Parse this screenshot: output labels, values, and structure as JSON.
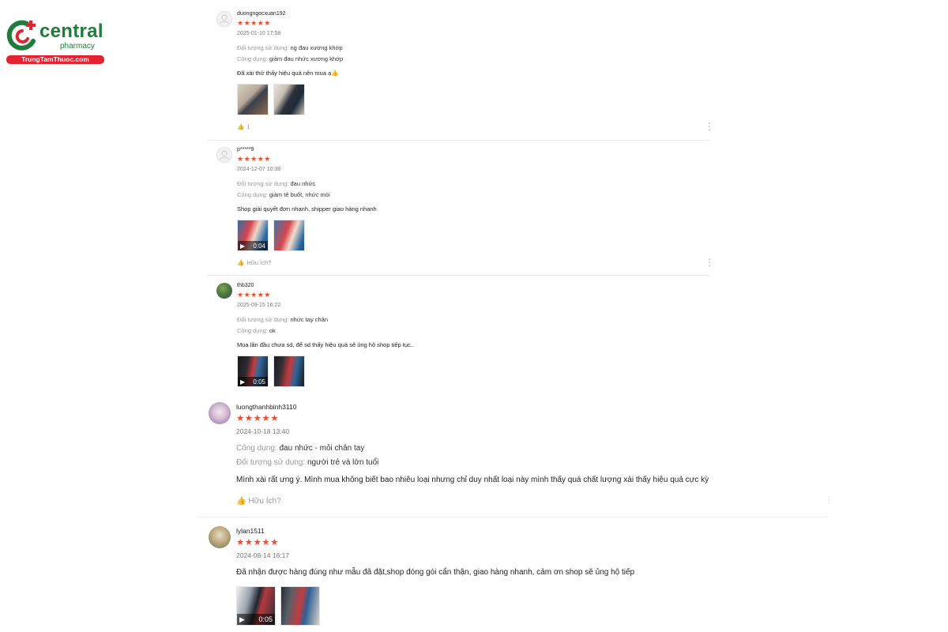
{
  "brand": {
    "name": "central",
    "sub": "pharmacy",
    "site": "TrungTamThuoc.com",
    "green": "#1e7d3a",
    "red": "#e42230"
  },
  "colors": {
    "star": "#ee4d2d"
  },
  "reviews": [
    {
      "username": "duongngocxuan192",
      "stars": "★★★★★",
      "date": "2025-01-10 17:58",
      "attributes": [
        {
          "key": "Đối tượng sử dụng:",
          "value": "ng đau xương khớp"
        },
        {
          "key": "Công dụng:",
          "value": "giảm đau nhức xương khớp"
        }
      ],
      "comment": "Đã xài thử thấy hiệu quả nên mua ạ👍",
      "media": [
        {
          "type": "image"
        },
        {
          "type": "image"
        }
      ],
      "like": "1",
      "avatar": "default-avatar-icon"
    },
    {
      "username": "p*****9",
      "stars": "★★★★★",
      "date": "2024-12-07 10:38",
      "attributes": [
        {
          "key": "Đối tượng sử dụng:",
          "value": "đau nhức"
        },
        {
          "key": "Công dụng:",
          "value": "giảm tê buốt, nhức mỏi"
        }
      ],
      "comment": "Shop giải quyết đơn nhanh, shipper giao hàng nhanh",
      "media": [
        {
          "type": "video",
          "duration": "0:04"
        },
        {
          "type": "image"
        }
      ],
      "like": "Hữu Ích?",
      "avatar": "default-avatar-icon"
    },
    {
      "username": "thb320",
      "stars": "★★★★★",
      "date": "2025-09-15 16:22",
      "attributes": [
        {
          "key": "Đối tượng sử dụng:",
          "value": "nhức tay chân"
        },
        {
          "key": "Công dụng:",
          "value": "ok"
        }
      ],
      "comment": "Mua lần đầu chưa sd, để sd thấy hiệu quả sẽ ủng hộ shop tiếp tục..",
      "media": [
        {
          "type": "video",
          "duration": "0:05"
        },
        {
          "type": "image"
        }
      ],
      "like": "",
      "avatar": "photo-avatar"
    },
    {
      "username": "luongthanhbinh3110",
      "stars": "★★★★★",
      "date": "2024-10-18 13:40",
      "attributes": [
        {
          "key": "Công dụng:",
          "value": "đau nhức - mỏi chân tay"
        },
        {
          "key": "Đối tượng sử dụng:",
          "value": "người trẻ và lớn tuổi"
        }
      ],
      "comment": "Mình xài rất ưng ý. Mình mua không biết bao nhiêu loại nhưng chỉ duy nhất loại này mình thấy quá chất lượng xài thấy hiệu quả cực kỳ",
      "media": [],
      "like": "Hữu Ích?",
      "avatar": "photo-avatar"
    },
    {
      "username": "lylan1511",
      "stars": "★★★★★",
      "date": "2024-08-14 16:17",
      "attributes": [],
      "comment": "Đã nhận được hàng đúng như mẫu đã đặt,shop đóng gói cẩn thận, giao hàng nhanh, cảm ơn shop sẽ ủng hộ tiếp",
      "media": [
        {
          "type": "video",
          "duration": "0:05"
        },
        {
          "type": "image"
        }
      ],
      "like": "",
      "avatar": "photo-avatar"
    }
  ]
}
